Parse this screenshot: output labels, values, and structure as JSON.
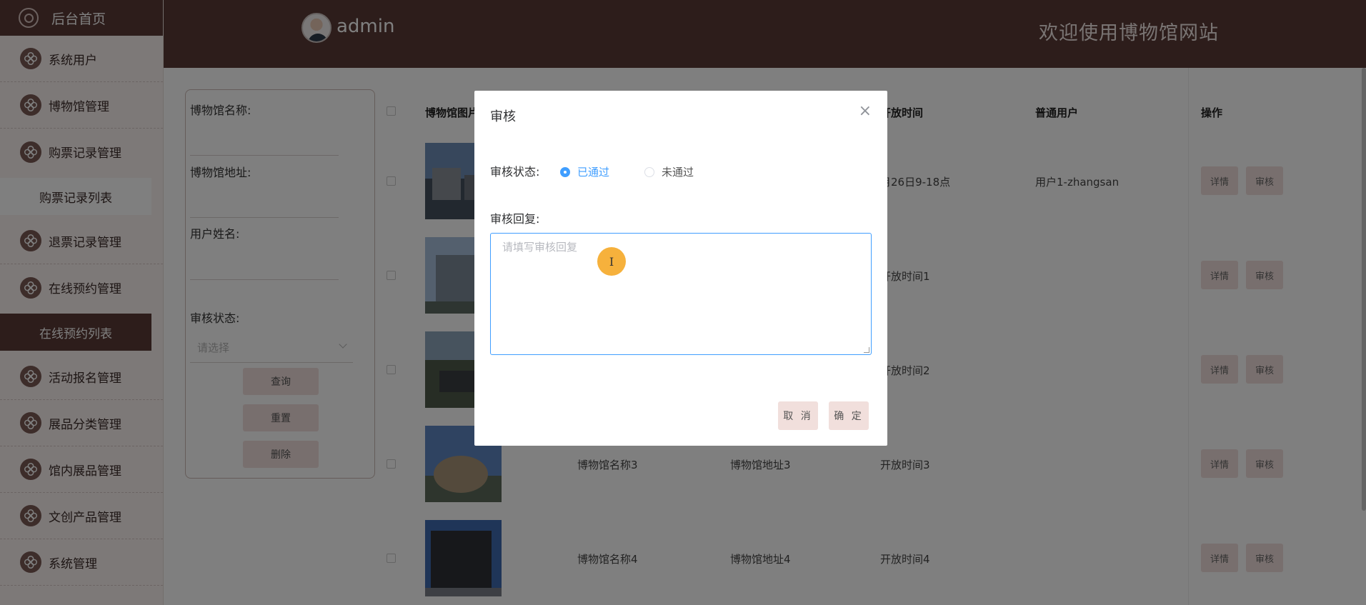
{
  "sidebar": {
    "home": "后台首页",
    "items": {
      "users": "系统用户",
      "museum": "博物馆管理",
      "ticket": "购票记录管理",
      "ticket_list": "购票记录列表",
      "refund": "退票记录管理",
      "booking": "在线预约管理",
      "booking_list": "在线预约列表",
      "activity": "活动报名管理",
      "category": "展品分类管理",
      "exhibit": "馆内展品管理",
      "product": "文创产品管理",
      "system": "系统管理"
    }
  },
  "header": {
    "user": "admin",
    "welcome": "欢迎使用博物馆网站"
  },
  "search": {
    "name_label": "博物馆名称:",
    "address_label": "博物馆地址:",
    "username_label": "用户姓名:",
    "status_label": "审核状态:",
    "status_placeholder": "请选择",
    "query": "查询",
    "reset": "重置",
    "delete": "删除"
  },
  "table": {
    "headers": {
      "image": "博物馆图片",
      "open_time": "开放时间",
      "user": "普通用户",
      "ops": "操作"
    },
    "rows": [
      {
        "name": "",
        "address": "",
        "open_time": "月26日9-18点",
        "user": "用户1-zhangsan"
      },
      {
        "name": "",
        "address": "",
        "open_time": "开放时间1",
        "user": ""
      },
      {
        "name": "",
        "address": "",
        "open_time": "开放时间2",
        "user": ""
      },
      {
        "name": "博物馆名称3",
        "address": "博物馆地址3",
        "open_time": "开放时间3",
        "user": ""
      },
      {
        "name": "博物馆名称4",
        "address": "博物馆地址4",
        "open_time": "开放时间4",
        "user": ""
      }
    ],
    "detail_btn": "详情",
    "audit_btn": "审核"
  },
  "modal": {
    "title": "审核",
    "close": "×",
    "status_label": "审核状态:",
    "status_options": {
      "passed": "已通过",
      "failed": "未通过"
    },
    "status_selected": "已通过",
    "reply_label": "审核回复:",
    "reply_placeholder": "请填写审核回复",
    "reply_value": "",
    "cancel": "取 消",
    "confirm": "确 定"
  },
  "cursor": "I",
  "colors": {
    "brand_dark": "#5b3b37",
    "accent": "#409eff",
    "button_bg": "#f1dfdc",
    "cursor": "#f6b13c"
  }
}
